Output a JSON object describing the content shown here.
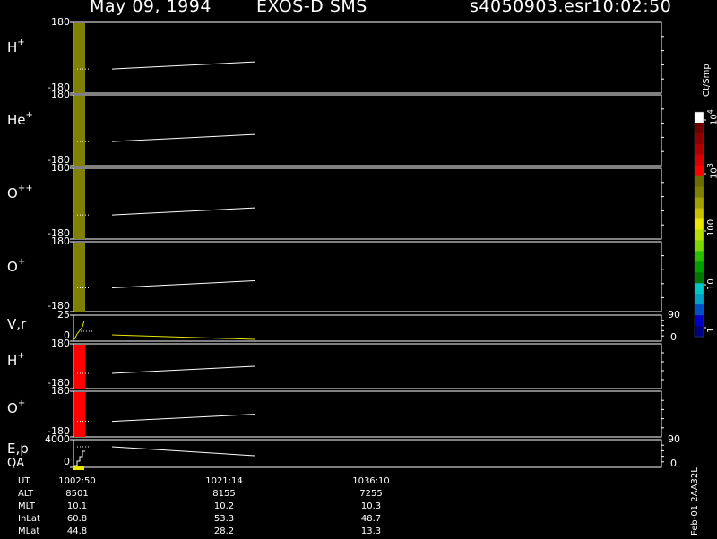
{
  "header": {
    "date": "May 09, 1994",
    "mission": "EXOS-D SMS",
    "filename": "s4050903.esr",
    "time": "10:02:50"
  },
  "colorbar": {
    "unit": "Ct/Smp",
    "ticks": [
      "1",
      "10",
      "100",
      "10",
      "10"
    ],
    "tick_exponents": [
      "",
      "",
      "",
      "3",
      "4"
    ],
    "colors": [
      "#000080",
      "#0000c8",
      "#0050c8",
      "#00a0c8",
      "#00c8c8",
      "#007800",
      "#00a000",
      "#28c000",
      "#78d800",
      "#b4e000",
      "#e8e800",
      "#c8c000",
      "#a0a000",
      "#808000",
      "#6c6c00",
      "#ff0000",
      "#d80000",
      "#b00000",
      "#900000",
      "#700000",
      "#ffffff"
    ]
  },
  "side_tag": "Feb-01 2AA32L",
  "time_table": {
    "rows": [
      {
        "label": "UT",
        "v1": "1002:50",
        "v2": "1021:14",
        "v3": "1036:10"
      },
      {
        "label": "ALT",
        "v1": "8501",
        "v2": "8155",
        "v3": "7255"
      },
      {
        "label": "MLT",
        "v1": "10.1",
        "v2": "10.2",
        "v3": "10.3"
      },
      {
        "label": "InLat",
        "v1": "60.8",
        "v2": "53.3",
        "v3": "48.7"
      },
      {
        "label": "MLat",
        "v1": "44.8",
        "v2": "28.2",
        "v3": "13.3"
      }
    ]
  },
  "chart_data": {
    "type": "heatmap",
    "x": [
      "1002:50",
      "1021:14",
      "1036:10"
    ],
    "panels": [
      {
        "label": "H",
        "charge": "+",
        "ytop": "180",
        "ybot": "-180",
        "block_color": "#808000",
        "right_top": "",
        "right_bot": ""
      },
      {
        "label": "He",
        "charge": "+",
        "ytop": "180",
        "ybot": "-180",
        "block_color": "#808000",
        "right_top": "",
        "right_bot": ""
      },
      {
        "label": "O",
        "charge": "++",
        "ytop": "180",
        "ybot": "-180",
        "block_color": "#808000",
        "right_top": "",
        "right_bot": ""
      },
      {
        "label": "O",
        "charge": "+",
        "ytop": "180",
        "ybot": "-180",
        "block_color": "#808000",
        "right_top": "",
        "right_bot": ""
      },
      {
        "label": "V,r",
        "charge": "",
        "ytop": "25",
        "ybot": "0",
        "block_color": "",
        "right_top": "90",
        "right_bot": "0"
      },
      {
        "label": "H",
        "charge": "+",
        "ytop": "180",
        "ybot": "-180",
        "block_color": "#ff0000",
        "right_top": "",
        "right_bot": ""
      },
      {
        "label": "O",
        "charge": "+",
        "ytop": "180",
        "ybot": "-180",
        "block_color": "#ff0000",
        "right_top": "",
        "right_bot": ""
      },
      {
        "label": "E,p",
        "charge": "",
        "ytop": "4000",
        "ybot": "0",
        "block_color": "",
        "right_top": "90",
        "right_bot": "0"
      }
    ],
    "qa_label": "QA"
  }
}
